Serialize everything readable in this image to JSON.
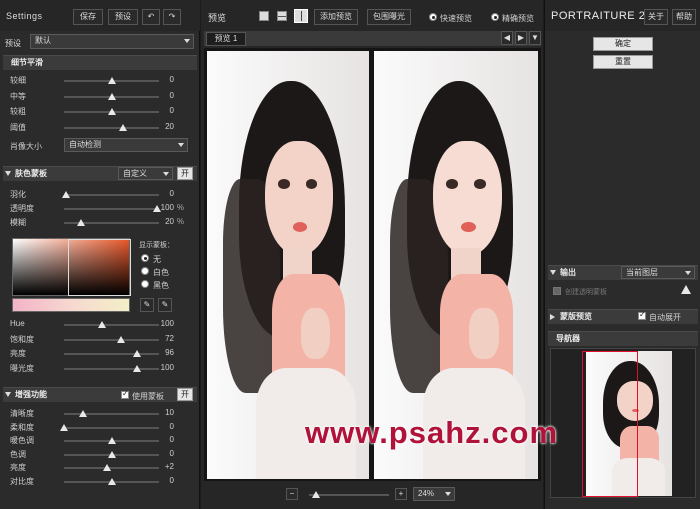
{
  "left": {
    "title": "Settings",
    "save_label": "保存",
    "preset_btn_label": "预设",
    "preset_label": "预设",
    "preset_value": "默认",
    "detail_section": {
      "title": "细节平滑",
      "rows": [
        {
          "label": "较细",
          "value": "0",
          "pos": 0.5
        },
        {
          "label": "中等",
          "value": "0",
          "pos": 0.5
        },
        {
          "label": "较粗",
          "value": "0",
          "pos": 0.5
        },
        {
          "label": "阈值",
          "value": "20",
          "pos": 0.62
        }
      ],
      "portrait_size_label": "肖像大小",
      "portrait_size_value": "自动检测"
    },
    "skin_section": {
      "title": "肤色蒙板",
      "mode_value": "自定义",
      "toggle_label": "开",
      "rows": [
        {
          "label": "羽化",
          "value": "0",
          "unit": "",
          "pos": 0.02
        },
        {
          "label": "透明度",
          "value": "100",
          "unit": "%",
          "pos": 0.98
        },
        {
          "label": "模糊",
          "value": "20",
          "unit": "%",
          "pos": 0.18
        }
      ],
      "show_mask_label": "显示蒙板：",
      "radio_options": [
        "无",
        "白色",
        "黑色"
      ],
      "radio_selected": 0,
      "hsl_rows": [
        {
          "label": "Hue",
          "value": "100",
          "pos": 0.4
        },
        {
          "label": "饱和度",
          "value": "72",
          "pos": 0.6
        },
        {
          "label": "亮度",
          "value": "96",
          "pos": 0.77
        },
        {
          "label": "曝光度",
          "value": "100",
          "pos": 0.77
        }
      ]
    },
    "enhance_section": {
      "title": "增强功能",
      "use_mask_label": "使用蒙板",
      "toggle_label": "开",
      "rows": [
        {
          "label": "清晰度",
          "value": "10",
          "pos": 0.2
        },
        {
          "label": "柔和度",
          "value": "0",
          "pos": 0.0
        },
        {
          "label": "暖色调",
          "value": "0",
          "pos": 0.5
        },
        {
          "label": "色调",
          "value": "0",
          "pos": 0.5
        },
        {
          "label": "亮度",
          "value": "+2",
          "pos": 0.45
        },
        {
          "label": "对比度",
          "value": "0",
          "pos": 0.5
        }
      ]
    }
  },
  "center": {
    "title": "预览",
    "add_preview_label": "添加预览",
    "pick_color_label": "包围曝光",
    "fast_preview_label": "快速预览",
    "precise_preview_label": "精确预览",
    "tab_label": "预览 1",
    "zoom_value": "24%",
    "zoom_minus": "−",
    "zoom_plus": "+",
    "watermark": "www.psahz.com"
  },
  "right": {
    "title_brand": "PORTRAITURE 2",
    "about_label": "关于",
    "help_label": "帮助",
    "ok_label": "确定",
    "reset_label": "重置",
    "output_label": "输出",
    "output_value": "当前图层",
    "create_layer_label": "创建透明蒙板",
    "mask_preview_label": "蒙版预览",
    "auto_expand_label": "自动展开",
    "navigator_label": "导航器"
  },
  "colors": {
    "panel_bg": "#2e2e2e",
    "watermark": "#b0123a"
  }
}
